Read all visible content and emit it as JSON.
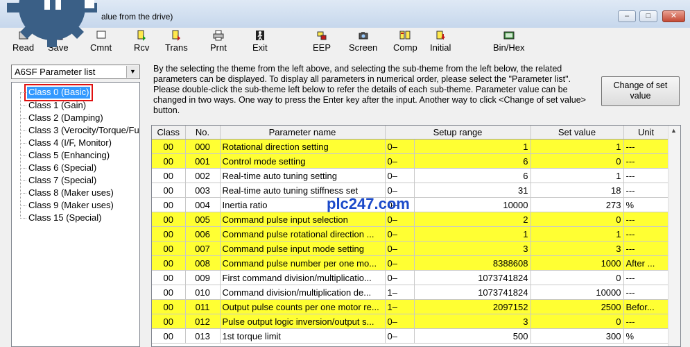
{
  "window": {
    "title": "alue from the drive)",
    "min_glyph": "–",
    "max_glyph": "□",
    "close_glyph": "✕"
  },
  "toolbar": [
    {
      "label": "Read",
      "icon": "read-icon"
    },
    {
      "label": "Save",
      "icon": "save-icon"
    },
    {
      "label": "Cmnt",
      "icon": "comment-icon"
    },
    {
      "label": "Rcv",
      "icon": "receive-icon"
    },
    {
      "label": "Trans",
      "icon": "transfer-icon"
    },
    {
      "label": "Prnt",
      "icon": "print-icon"
    },
    {
      "label": "Exit",
      "icon": "exit-icon"
    },
    {
      "label": "EEP",
      "icon": "eeprom-icon"
    },
    {
      "label": "Screen",
      "icon": "camera-icon"
    },
    {
      "label": "Comp",
      "icon": "compare-icon"
    },
    {
      "label": "Initial",
      "icon": "initial-icon"
    },
    {
      "label": "Bin/Hex",
      "icon": "binhex-icon"
    }
  ],
  "param_list_select": {
    "value": "A6SF Parameter list"
  },
  "tree": [
    {
      "label": "Class 0 (Basic)",
      "selected": true
    },
    {
      "label": "Class 1 (Gain)"
    },
    {
      "label": "Class 2 (Damping)"
    },
    {
      "label": "Class 3 (Verocity/Torque/Fu"
    },
    {
      "label": "Class 4 (I/F, Monitor)"
    },
    {
      "label": "Class 5 (Enhancing)"
    },
    {
      "label": "Class 6 (Special)"
    },
    {
      "label": "Class 7 (Special)"
    },
    {
      "label": "Class 8 (Maker uses)"
    },
    {
      "label": "Class 9 (Maker uses)"
    },
    {
      "label": "Class 15 (Special)"
    }
  ],
  "description": "By the selecting the theme from the left above, and selecting the sub-theme from the left below, the related parameters can be displayed. To display all parameters in numerical order, please select the \"Parameter list\". Please double-click the sub-theme left below to refer the details of each sub-theme. Parameter value can be changed in two ways. One way to press the Enter key after the input. Another way to click <Change of set value> button.",
  "change_button": {
    "line1": "Change of set",
    "line2": "value"
  },
  "table": {
    "headers": {
      "class": "Class",
      "no": "No.",
      "name": "Parameter name",
      "range": "Setup range",
      "set": "Set value",
      "unit": "Unit"
    },
    "rows": [
      {
        "cls": "00",
        "no": "000",
        "name": "Rotational direction setting",
        "min": "0–",
        "max": "1",
        "set": "1",
        "unit": "---",
        "hl": true
      },
      {
        "cls": "00",
        "no": "001",
        "name": "Control mode setting",
        "min": "0–",
        "max": "6",
        "set": "0",
        "unit": "---",
        "hl": true
      },
      {
        "cls": "00",
        "no": "002",
        "name": "Real-time auto tuning setting",
        "min": "0–",
        "max": "6",
        "set": "1",
        "unit": "---",
        "hl": false
      },
      {
        "cls": "00",
        "no": "003",
        "name": "Real-time auto tuning stiffness set",
        "min": "0–",
        "max": "31",
        "set": "18",
        "unit": "---",
        "hl": false
      },
      {
        "cls": "00",
        "no": "004",
        "name": "Inertia ratio",
        "min": "0–",
        "max": "10000",
        "set": "273",
        "unit": "%",
        "hl": false
      },
      {
        "cls": "00",
        "no": "005",
        "name": "Command pulse input selection",
        "min": "0–",
        "max": "2",
        "set": "0",
        "unit": "---",
        "hl": true
      },
      {
        "cls": "00",
        "no": "006",
        "name": "Command pulse rotational direction ...",
        "min": "0–",
        "max": "1",
        "set": "1",
        "unit": "---",
        "hl": true
      },
      {
        "cls": "00",
        "no": "007",
        "name": "Command pulse input mode setting",
        "min": "0–",
        "max": "3",
        "set": "3",
        "unit": "---",
        "hl": true
      },
      {
        "cls": "00",
        "no": "008",
        "name": "Command pulse number per one mo...",
        "min": "0–",
        "max": "8388608",
        "set": "1000",
        "unit": "After ...",
        "hl": true
      },
      {
        "cls": "00",
        "no": "009",
        "name": "First command division/multiplicatio...",
        "min": "0–",
        "max": "1073741824",
        "set": "0",
        "unit": "---",
        "hl": false
      },
      {
        "cls": "00",
        "no": "010",
        "name": "Command division/multiplication de...",
        "min": "1–",
        "max": "1073741824",
        "set": "10000",
        "unit": "---",
        "hl": false
      },
      {
        "cls": "00",
        "no": "011",
        "name": "Output pulse counts per one motor re...",
        "min": "1–",
        "max": "2097152",
        "set": "2500",
        "unit": "Befor...",
        "hl": true
      },
      {
        "cls": "00",
        "no": "012",
        "name": "Pulse output logic inversion/output s...",
        "min": "0–",
        "max": "3",
        "set": "0",
        "unit": "---",
        "hl": true
      },
      {
        "cls": "00",
        "no": "013",
        "name": "1st torque limit",
        "min": "0–",
        "max": "500",
        "set": "300",
        "unit": "%",
        "hl": false
      }
    ]
  },
  "watermark": "plc247.com"
}
